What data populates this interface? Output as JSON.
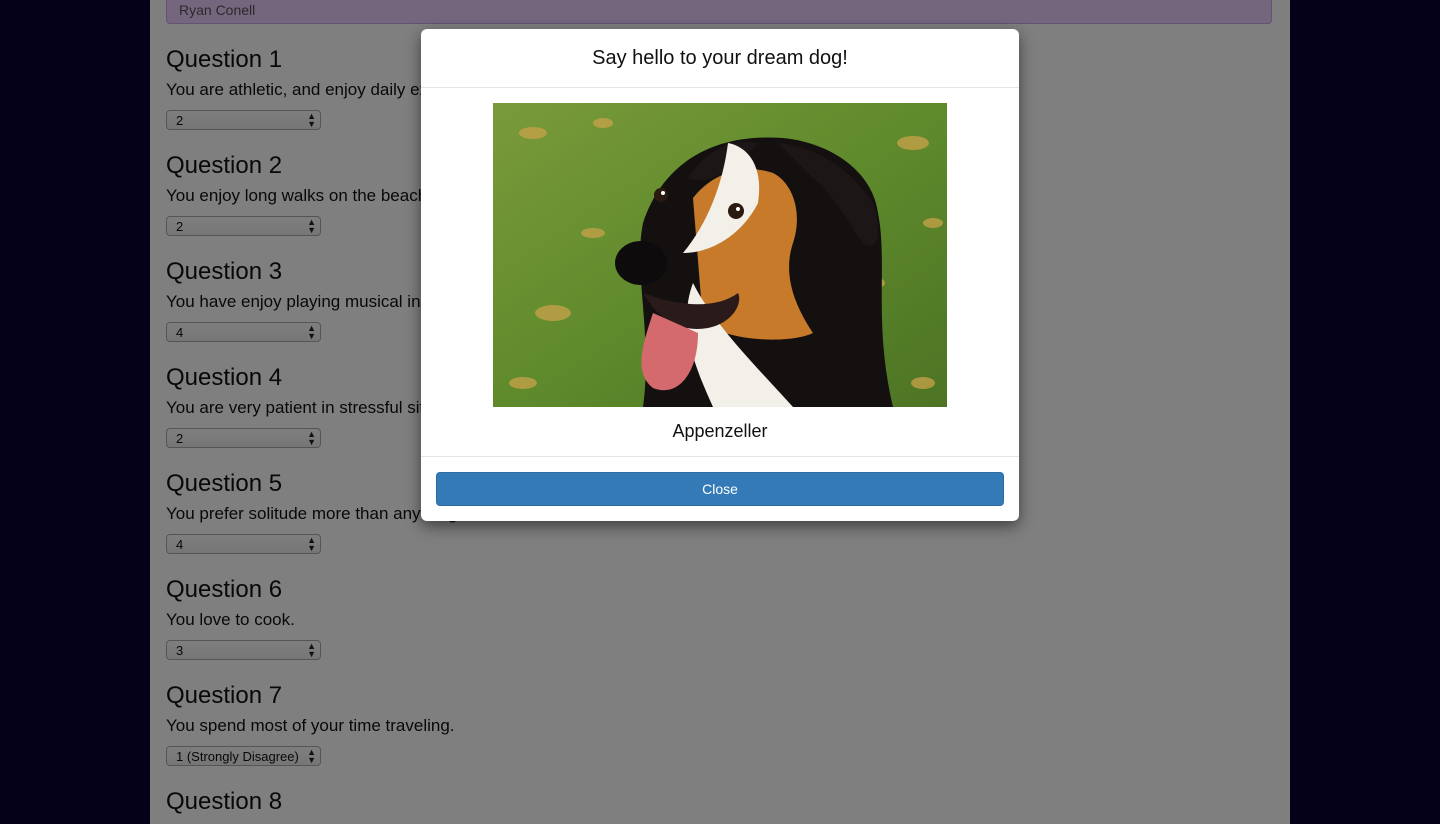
{
  "name_field": {
    "value": "Ryan Conell"
  },
  "questions": [
    {
      "title": "Question 1",
      "text": "You are athletic, and enjoy daily exercise.",
      "selected": "2"
    },
    {
      "title": "Question 2",
      "text": "You enjoy long walks on the beach.",
      "selected": "2"
    },
    {
      "title": "Question 3",
      "text": "You have enjoy playing musical instruments.",
      "selected": "4"
    },
    {
      "title": "Question 4",
      "text": "You are very patient in stressful situations.",
      "selected": "2"
    },
    {
      "title": "Question 5",
      "text": "You prefer solitude more than anything else.",
      "selected": "4"
    },
    {
      "title": "Question 6",
      "text": "You love to cook.",
      "selected": "3"
    },
    {
      "title": "Question 7",
      "text": "You spend most of your time traveling.",
      "selected": "1 (Strongly Disagree)"
    },
    {
      "title": "Question 8",
      "text": "",
      "selected": ""
    }
  ],
  "modal": {
    "title": "Say hello to your dream dog!",
    "dog_name": "Appenzeller",
    "close_label": "Close"
  },
  "colors": {
    "page_background": "#0a0230",
    "name_field_background": "#e7ccfb",
    "close_button": "#337ab7"
  }
}
